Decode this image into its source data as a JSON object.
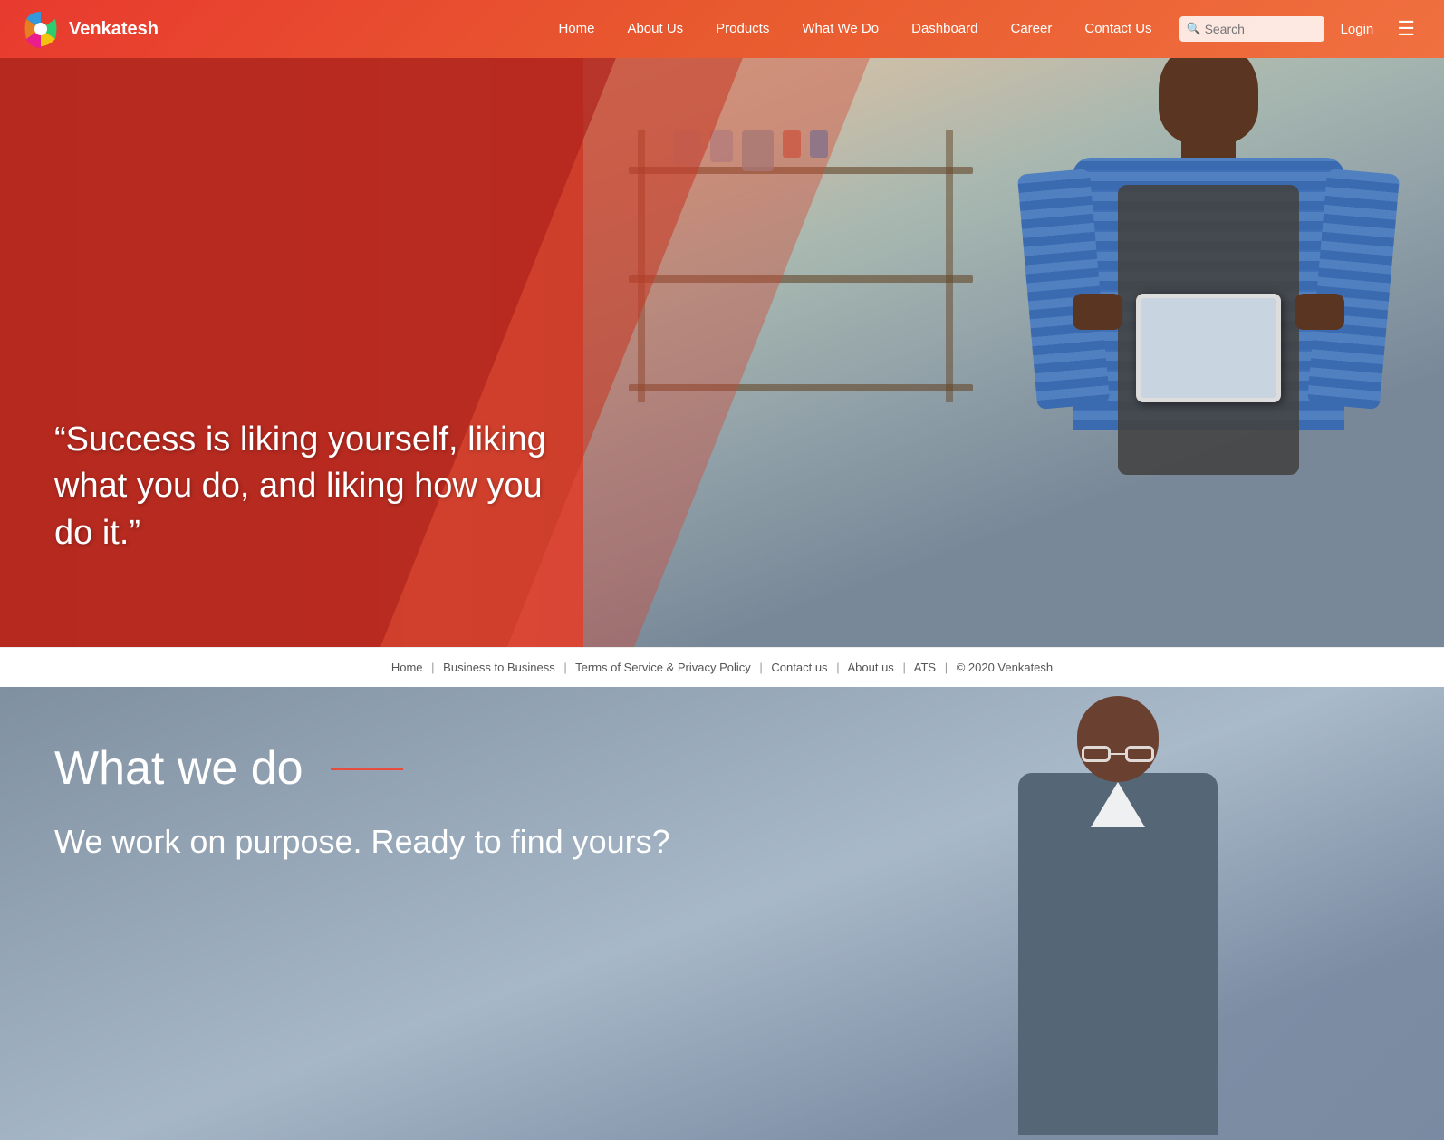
{
  "brand": {
    "logo_alt": "Venkatesh logo",
    "name": "Venkatesh"
  },
  "navbar": {
    "links": [
      {
        "label": "Home",
        "href": "#"
      },
      {
        "label": "About Us",
        "href": "#"
      },
      {
        "label": "Products",
        "href": "#"
      },
      {
        "label": "What We Do",
        "href": "#"
      },
      {
        "label": "Dashboard",
        "href": "#"
      },
      {
        "label": "Career",
        "href": "#"
      },
      {
        "label": "Contact Us",
        "href": "#"
      }
    ],
    "search_placeholder": "Search",
    "login_label": "Login"
  },
  "hero": {
    "quote": "“Success is liking yourself, liking what you do, and liking how you do it.”"
  },
  "footer_bar": {
    "links": [
      {
        "label": "Home"
      },
      {
        "label": "Business to Business"
      },
      {
        "label": "Terms of Service & Privacy Policy"
      },
      {
        "label": "Contact us"
      },
      {
        "label": "About us"
      },
      {
        "label": "ATS"
      }
    ],
    "copyright": "© 2020 Venkatesh"
  },
  "what_we_do": {
    "title": "What we do",
    "underline": "",
    "subtitle": "We work on purpose. Ready to find yours?"
  },
  "icons": {
    "search": "🔍",
    "hamburger": "☰",
    "search_unicode": "&#128269;"
  }
}
